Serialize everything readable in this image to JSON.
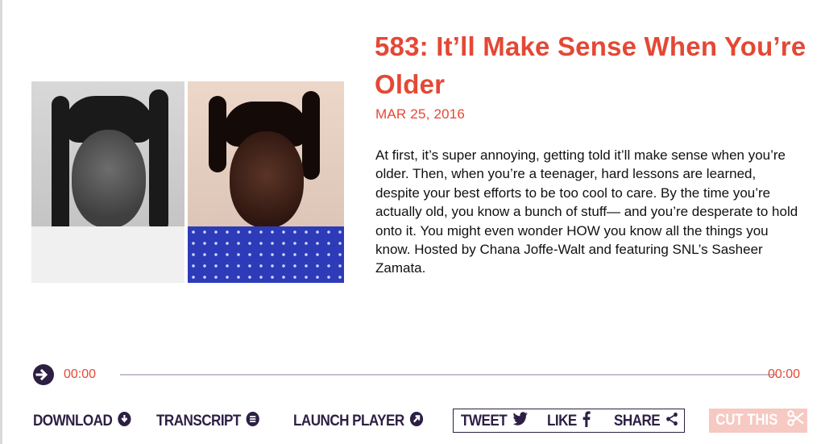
{
  "episode": {
    "title": "583: It’ll Make Sense When You’re Older",
    "date": "MAR 25, 2016",
    "description": "At first, it’s super annoying, getting told it’ll make sense when you’re older. Then, when you’re a teenager, hard lessons are learned, despite your best efforts to be too cool to care. By the time you’re actually old, you know a bunch of stuff— and you’re desperate to hold onto it. You might even wonder HOW you know all the things you know. Hosted by Chana Joffe-Walt and featuring SNL’s Sasheer Zamata."
  },
  "player": {
    "elapsed": "00:00",
    "duration": "00:00",
    "play_icon": "play-arrow-icon"
  },
  "actions": {
    "download": {
      "label": "DOWNLOAD",
      "icon": "download-circle-icon"
    },
    "transcript": {
      "label": "TRANSCRIPT",
      "icon": "transcript-lines-icon"
    },
    "launch_player": {
      "label": "LAUNCH PLAYER",
      "icon": "launch-arrow-icon"
    }
  },
  "social": {
    "tweet": {
      "label": "TWEET",
      "icon": "twitter-bird-icon"
    },
    "like": {
      "label": "LIKE",
      "icon": "facebook-f-icon"
    },
    "share": {
      "label": "SHARE",
      "icon": "share-icon"
    }
  },
  "cut": {
    "label": "CUT THIS",
    "icon": "scissors-icon"
  },
  "colors": {
    "accent": "#e44835",
    "dark": "#2d1f44",
    "cut_bg": "#f6c9c2"
  }
}
